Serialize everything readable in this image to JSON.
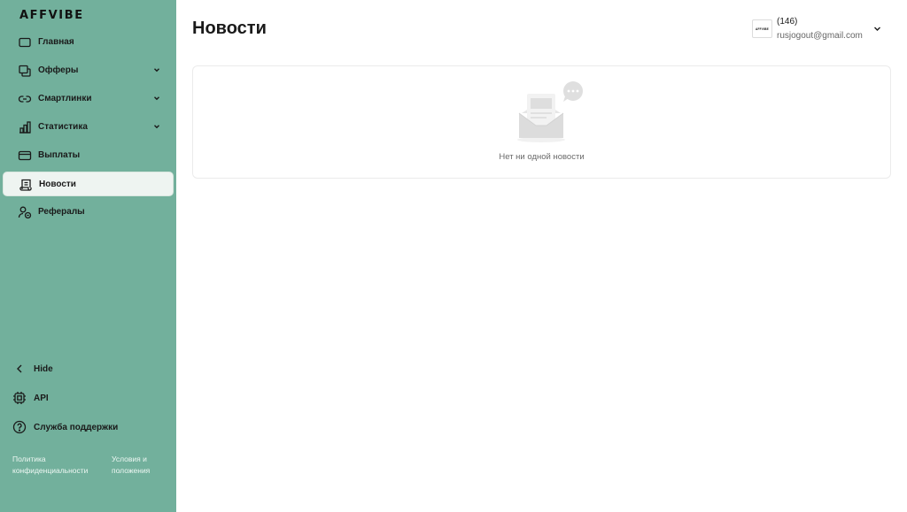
{
  "brand": {
    "logo_text": "AFFVIBE"
  },
  "sidebar": {
    "items": [
      {
        "label": "Главная",
        "icon": "square-icon",
        "has_submenu": false,
        "active": false
      },
      {
        "label": "Офферы",
        "icon": "stacked-squares-icon",
        "has_submenu": true,
        "active": false
      },
      {
        "label": "Смартлинки",
        "icon": "link-icon",
        "has_submenu": true,
        "active": false
      },
      {
        "label": "Статистика",
        "icon": "bar-chart-icon",
        "has_submenu": true,
        "active": false
      },
      {
        "label": "Выплаты",
        "icon": "credit-card-icon",
        "has_submenu": false,
        "active": false
      },
      {
        "label": "Новости",
        "icon": "receipt-icon",
        "has_submenu": false,
        "active": true
      },
      {
        "label": "Рефералы",
        "icon": "referral-user-icon",
        "has_submenu": false,
        "active": false
      }
    ],
    "bottom": {
      "hide_label": "Hide",
      "api_label": "API",
      "support_label": "Служба поддержки",
      "privacy_label": "Политика конфиденциальности",
      "terms_label": "Условия и положения"
    }
  },
  "header": {
    "title": "Новости",
    "user": {
      "logo_text": "AFFVIBE",
      "count": "(146)",
      "email": "rusjogout@gmail.com"
    }
  },
  "main": {
    "empty_state": {
      "text": "Нет ни одной новости"
    }
  },
  "colors": {
    "sidebar_bg": "#72b09c",
    "active_item_bg": "#eef4f1",
    "card_border": "#ebebeb"
  }
}
